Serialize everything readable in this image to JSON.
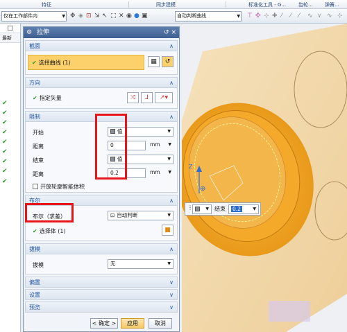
{
  "ribbon": {
    "groups": [
      "特征",
      "同步建模",
      "标准化工具 - G...",
      "齿轮...",
      "弹簧..."
    ]
  },
  "toolbar": {
    "filter_combo": "仅在工作部件内",
    "curve_rule_combo": "自动判断曲线"
  },
  "left_panel": {
    "header_icon": "□",
    "column_label": "最新",
    "checkmarks": 9
  },
  "dialog": {
    "title": "拉伸",
    "title_buttons": "↺ ×",
    "sections": {
      "section": {
        "header": "截面",
        "select_curve_label": "选择曲线 (1)"
      },
      "direction": {
        "header": "方向",
        "specify_vector_label": "指定矢量"
      },
      "limits": {
        "header": "限制",
        "start_label": "开始",
        "start_value": "值",
        "distance1_label": "距离",
        "distance1_value": "0",
        "distance1_unit": "mm",
        "end_label": "结束",
        "end_value": "值",
        "distance2_label": "距离",
        "distance2_value": "0.2",
        "distance2_unit": "mm",
        "open_profile_label": "开放轮廓智能体积"
      },
      "boolean": {
        "header": "布尔",
        "boolean_label": "布尔（求差）",
        "boolean_value": "自动判断",
        "select_body_label": "选择体 (1)"
      },
      "draft": {
        "header": "拔模",
        "draft_label": "拔模",
        "draft_value": "无"
      },
      "offset": {
        "header": "偏置"
      },
      "settings": {
        "header": "设置"
      },
      "preview": {
        "header": "预览"
      }
    },
    "buttons": {
      "ok": "< 确定 >",
      "apply": "应用",
      "cancel": "取消"
    }
  },
  "viewport": {
    "axis_label": "Z",
    "minibar_label": "结束",
    "minibar_value": "0.2"
  },
  "colors": {
    "highlight_red": "#e8141b",
    "selection_yellow": "#fcd06b",
    "part_orange": "#f4a11c",
    "accent_blue": "#2356a3"
  }
}
